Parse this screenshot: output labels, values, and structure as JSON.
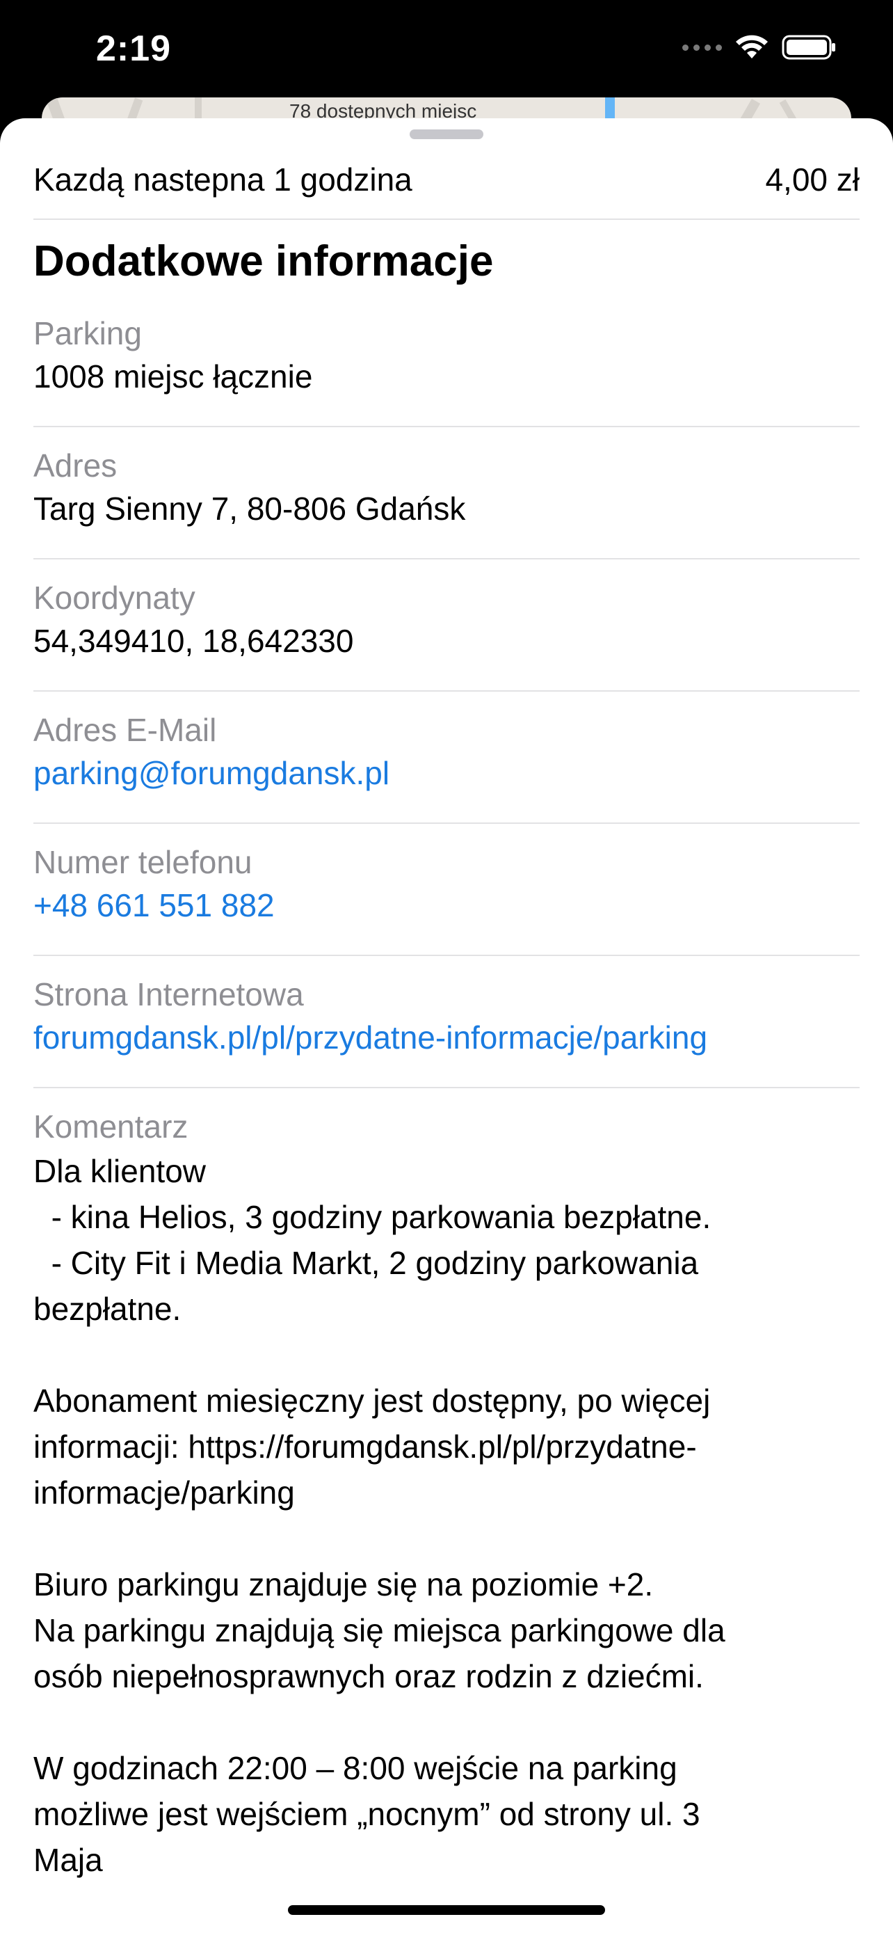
{
  "status_bar": {
    "time": "2:19"
  },
  "map_peek": {
    "label": "78 dostępnych miejsc"
  },
  "price_row": {
    "label": "Kazdą nastepna 1 godzina",
    "value": "4,00 zł"
  },
  "section": {
    "title": "Dodatkowe informacje"
  },
  "items": [
    {
      "label": "Parking",
      "value": "1008 miejsc łącznie"
    },
    {
      "label": "Adres",
      "value": "Targ Sienny 7, 80-806 Gdańsk"
    },
    {
      "label": "Koordynaty",
      "value": "54,349410, 18,642330"
    },
    {
      "label": "Adres E-Mail",
      "value": "parking@forumgdansk.pl"
    },
    {
      "label": "Numer telefonu",
      "value": "+48 661 551 882"
    },
    {
      "label": "Strona Internetowa",
      "value": "forumgdansk.pl/pl/przydatne-informacje/parking"
    }
  ],
  "comment": {
    "label": "Komentarz",
    "text": "Dla klientow\n  - kina Helios, 3 godziny parkowania bezpłatne.\n  - City Fit i Media Markt, 2 godziny parkowania\nbezpłatne.\n\nAbonament miesięczny jest dostępny, po więcej\ninformacji: https://forumgdansk.pl/pl/przydatne-\ninformacje/parking\n\nBiuro parkingu znajduje się na poziomie +2.\nNa parkingu znajdują się miejsca parkingowe dla\nosób niepełnosprawnych oraz rodzin z dziećmi.\n\nW godzinach 22:00 – 8:00 wejście na parking\nmożliwe jest wejściem „nocnym” od strony ul. 3\nMaja"
  },
  "colors": {
    "link": "#1a7be0",
    "label_gray": "#8e8e93",
    "divider": "#e2e2e4"
  }
}
